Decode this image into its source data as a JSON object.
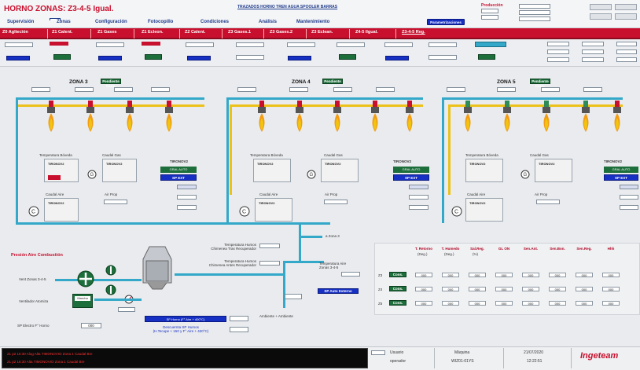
{
  "app": {
    "title": "HORNO ZONAS: Z3-4-5 Igual.",
    "header_center": "TRAZADOS HORNO TREN AGUA SPOOLER BARRAS",
    "header_btn": "Parametrizaciones",
    "header_right_label": "Producción"
  },
  "menu": [
    "Supervisión",
    "Zonas",
    "Configuración",
    "Fotocopillo",
    "Condiciones",
    "Análisis",
    "Mantenimiento"
  ],
  "active_menu": "Zonas",
  "zone_tabs": [
    "Z0 Aglteción",
    "Z1 Calent.",
    "Z1 Gases",
    "Z1 Ecleon.",
    "Z2 Calent.",
    "Z3 Gases.1",
    "Z3 Gases.2",
    "Z3 Eclean.",
    "Z4-5 Ilgual.",
    "Z3-4-5 Reg."
  ],
  "zones": [
    {
      "title": "ZONA 3",
      "state_btn": "Pendiente Cons.",
      "regulator": "TIRONOV2"
    },
    {
      "title": "ZONA 4",
      "state_btn": "Pendiente Cons.",
      "regulator": "TIRONOV2"
    },
    {
      "title": "ZONA 5",
      "state_btn": "Pendiente Cons.",
      "regulator": "TIRONOV2"
    }
  ],
  "zone_labels": {
    "temp_bovedo": "Temperatura Bóveda",
    "caudal_gas": "Caudal Gas",
    "caudal_aire": "Caudal Aire",
    "aire_ppal": "Air Prop",
    "reg_title": "TIRONOV2",
    "auto_label": "GRAL AUTO",
    "sp_ext": "SP EXT"
  },
  "pressure_section": {
    "title": "Presión Aire Combustión",
    "vent1": "Vent Zonas 3-4-5",
    "vent2": "Ventilador Atomiza",
    "sp_label": "SP Electro F° Horno",
    "sp_value": "000",
    "btn_marcha": "Marcha",
    "temp_humos1": "Temperatura Humos\nChimenea Tras Recuperador",
    "temp_humos2": "Temperatura Humos\nChimenea Antes Recuperador",
    "zona_label": "a Zona 3",
    "temp_aire": "Temperatura Aire\nZonas 3-4-5",
    "sp_auto_button": "SP Auto Externo",
    "sp_horno_label": "SP Horno (F° Aire + 400°C)",
    "desc_label": "Descuernta SP Humos\n(H.Tecupe + 150 y F° Aire + 420°C)",
    "ambient_label": "Ambiente + Ambiente"
  },
  "table": {
    "headers": [
      "T. Retorno",
      "T. Humedo",
      "Sal.Reg.",
      "GL ON",
      "Sen.Ant.",
      "Sen.Bon.",
      "Sen.Reg.",
      "Hhh"
    ],
    "units": [
      "(Deg.)",
      "(Deg.)",
      "(%)",
      "",
      "",
      "",
      "",
      ""
    ],
    "rows": [
      {
        "zone": "Z3",
        "button": "Cons.",
        "values": [
          "000",
          "000",
          "000",
          "000",
          "000",
          "000",
          "000",
          "000"
        ]
      },
      {
        "zone": "Z4",
        "button": "Cons.",
        "values": [
          "000",
          "000",
          "000",
          "000",
          "000",
          "000",
          "000",
          "000"
        ]
      },
      {
        "zone": "Z5",
        "button": "Cons.",
        "values": [
          "000",
          "000",
          "000",
          "000",
          "000",
          "000",
          "000",
          "000"
        ]
      }
    ]
  },
  "alarms": [
    "21 p2   16:30   Alog Alta    TIMONOVIO Zona 1 Caudal Bre",
    "21 p2   16:30   Alta         TIMONOVIO Zona 1 Caudal Bre"
  ],
  "status": {
    "user_label": "Usuario",
    "user_value": "operador",
    "machine_label": "Máquina",
    "machine_value": "WIZ01-01YS",
    "date": "21/07/2020",
    "time": "12:22:51",
    "brand": "Ingeteam"
  },
  "colors": {
    "accent": "#c8102e",
    "pipe_air": "#33a8c8",
    "pipe_gas": "#ecc21a",
    "btn_green": "#1c6e3a",
    "btn_blue": "#1730c4"
  }
}
